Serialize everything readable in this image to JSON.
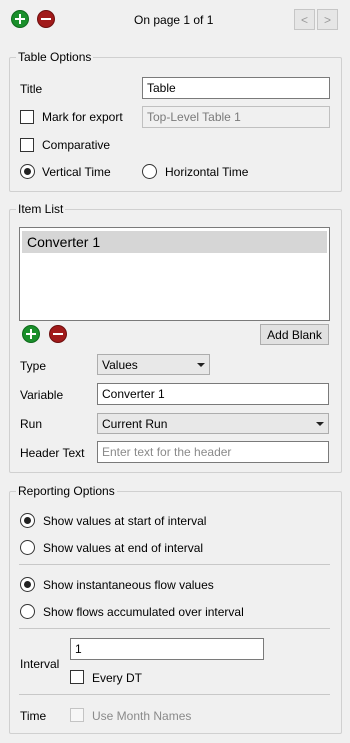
{
  "toolbar": {
    "add_icon": "plus-icon",
    "remove_icon": "minus-icon",
    "page_status": "On page 1 of 1",
    "prev_label": "<",
    "next_label": ">"
  },
  "table_options": {
    "legend": "Table Options",
    "title_label": "Title",
    "title_value": "Table",
    "mark_export_label": "Mark for export",
    "mark_export_value": "Top-Level Table 1",
    "comparative_label": "Comparative",
    "vertical_time_label": "Vertical Time",
    "horizontal_time_label": "Horizontal Time"
  },
  "item_list": {
    "legend": "Item List",
    "items": [
      "Converter 1"
    ],
    "add_blank_label": "Add Blank",
    "type_label": "Type",
    "type_value": "Values",
    "variable_label": "Variable",
    "variable_value": "Converter 1",
    "run_label": "Run",
    "run_value": "Current Run",
    "header_text_label": "Header Text",
    "header_text_placeholder": "Enter text for the header"
  },
  "reporting_options": {
    "legend": "Reporting Options",
    "start_interval_label": "Show values at start of interval",
    "end_interval_label": "Show values at end of interval",
    "instantaneous_label": "Show instantaneous flow values",
    "accumulated_label": "Show flows accumulated over interval",
    "interval_label": "Interval",
    "interval_value": "1",
    "every_dt_label": "Every DT",
    "time_label": "Time",
    "month_names_label": "Use Month Names"
  },
  "colors": {
    "add_green": "#1a8f2b",
    "remove_red": "#a11a1a",
    "panel_bg": "#f0f0f0"
  }
}
